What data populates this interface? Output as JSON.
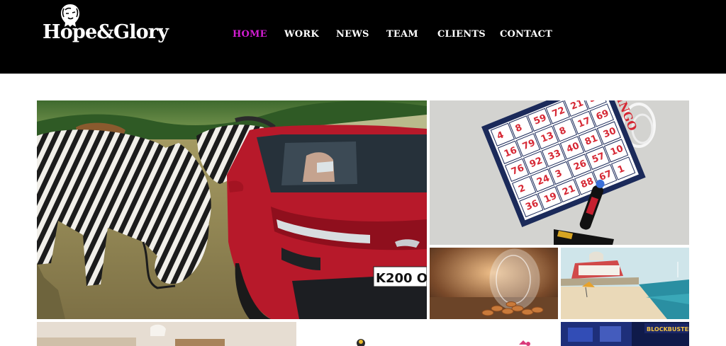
{
  "brand": {
    "name": "Hope&Glory",
    "logo_icon": "lion-head-icon"
  },
  "nav": {
    "items": [
      {
        "label": "HOME",
        "active": true
      },
      {
        "label": "WORK",
        "active": false
      },
      {
        "label": "NEWS",
        "active": false
      },
      {
        "label": "TEAM",
        "active": false
      },
      {
        "label": "CLIENTS",
        "active": false
      },
      {
        "label": "CONTACT",
        "active": false
      }
    ]
  },
  "colors": {
    "header_bg": "#000000",
    "nav_text": "#ffffff",
    "nav_active": "#d21dd2",
    "page_bg": "#ffffff"
  },
  "tiles": {
    "zebras_car": {
      "plate": "K200 O"
    },
    "bingo": {
      "title": "BINGO",
      "numbers": [
        "4",
        "8",
        "59",
        "72",
        "21",
        "55",
        "16",
        "79",
        "13",
        "8",
        "17",
        "69",
        "76",
        "92",
        "33",
        "40",
        "81",
        "30",
        "2",
        "24",
        "3",
        "26",
        "57",
        "10",
        "36",
        "19",
        "21",
        "88",
        "67",
        "1"
      ]
    },
    "blockbuster": {
      "sign": "BLOCKBUSTER"
    }
  }
}
